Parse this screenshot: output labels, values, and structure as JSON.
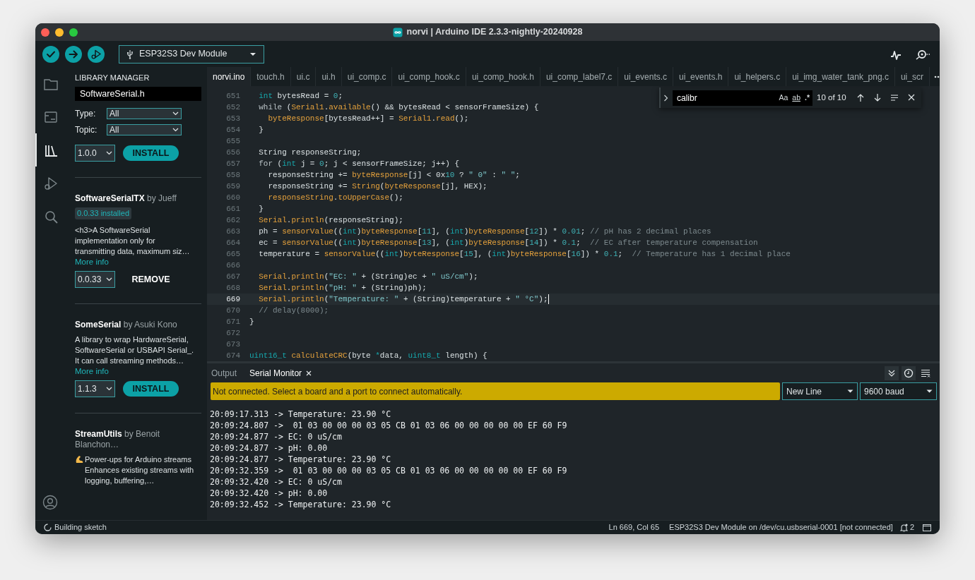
{
  "window": {
    "title": "norvi | Arduino IDE 2.3.3-nightly-20240928"
  },
  "toolbar": {
    "buttons": [
      {
        "kind": "verify"
      },
      {
        "kind": "upload"
      },
      {
        "kind": "debug"
      }
    ],
    "board": "ESP32S3 Dev Module",
    "right": [
      {
        "kind": "plotter"
      },
      {
        "kind": "monitor"
      }
    ]
  },
  "activity_bar": [
    {
      "kind": "folder",
      "selected": false
    },
    {
      "kind": "boards",
      "selected": false
    },
    {
      "kind": "library",
      "selected": true
    },
    {
      "kind": "debug",
      "selected": false
    },
    {
      "kind": "search",
      "selected": false
    }
  ],
  "library_manager": {
    "title": "LIBRARY MANAGER",
    "search": "SoftwareSerial.h",
    "filters": [
      {
        "label": "Type:",
        "value": "All"
      },
      {
        "label": "Topic:",
        "value": "All"
      }
    ],
    "items": [
      {
        "version": "1.0.0",
        "action": {
          "kind": "install",
          "label": "INSTALL"
        }
      },
      {
        "heading": "**SoftwareSerialTX** by Jueff",
        "installed": "0.0.33 installed",
        "description": "<h3>A SoftwareSerial implementation only for transmitting data, maximum siz…",
        "more_info": "More info",
        "version": "0.0.33",
        "action": {
          "kind": "remove",
          "label": "REMOVE"
        }
      },
      {
        "heading": "**SomeSerial** by Asuki Kono",
        "description": "A library to wrap HardwareSerial, SoftwareSerial or USBAPI Serial_. It can call streaming methods…",
        "more_info": "More info",
        "version": "1.1.3",
        "action": {
          "kind": "install",
          "label": "INSTALL"
        }
      },
      {
        "heading": "**StreamUtils** by Benoit Blanchon…",
        "emoji_icon": true,
        "description": "Power-ups for Arduino streams Enhances existing streams with logging, buffering,…"
      }
    ]
  },
  "editor_tabs": [
    {
      "label": "norvi.ino",
      "selected": true
    },
    {
      "label": "touch.h",
      "selected": false
    },
    {
      "label": "ui.c",
      "selected": false
    },
    {
      "label": "ui.h",
      "selected": false
    },
    {
      "label": "ui_comp.c",
      "selected": false
    },
    {
      "label": "ui_comp_hook.c",
      "selected": false
    },
    {
      "label": "ui_comp_hook.h",
      "selected": false
    },
    {
      "label": "ui_comp_label7.c",
      "selected": false
    },
    {
      "label": "ui_events.c",
      "selected": false
    },
    {
      "label": "ui_events.h",
      "selected": false
    },
    {
      "label": "ui_helpers.c",
      "selected": false
    },
    {
      "label": "ui_img_water_tank_png.c",
      "selected": false
    },
    {
      "label": "ui_scr",
      "selected": false
    }
  ],
  "find": {
    "query": "calibr",
    "options": [
      "Aa",
      "ab",
      ".*"
    ],
    "count": "10 of 10"
  },
  "code_lines": [
    {
      "number": "651",
      "current": false,
      "tokens": [
        {
          "kind": "type",
          "text": "  int"
        },
        {
          "kind": "plain",
          "text": " bytesRead = "
        },
        {
          "kind": "num",
          "text": "0"
        },
        {
          "kind": "plain",
          "text": ";"
        }
      ]
    },
    {
      "number": "652",
      "current": false,
      "tokens": [
        {
          "kind": "kw",
          "text": "  while"
        },
        {
          "kind": "plain",
          "text": " ("
        },
        {
          "kind": "fn",
          "text": "Serial1"
        },
        {
          "kind": "plain",
          "text": "."
        },
        {
          "kind": "fn",
          "text": "available"
        },
        {
          "kind": "plain",
          "text": "() && bytesRead < sensorFrameSize) {"
        }
      ]
    },
    {
      "number": "653",
      "current": false,
      "tokens": [
        {
          "kind": "fn",
          "text": "    byteResponse"
        },
        {
          "kind": "plain",
          "text": "[bytesRead++] = "
        },
        {
          "kind": "fn",
          "text": "Serial1"
        },
        {
          "kind": "plain",
          "text": "."
        },
        {
          "kind": "fn",
          "text": "read"
        },
        {
          "kind": "plain",
          "text": "();"
        }
      ]
    },
    {
      "number": "654",
      "current": false,
      "tokens": [
        {
          "kind": "plain",
          "text": "  }"
        }
      ]
    },
    {
      "number": "655",
      "current": false
    },
    {
      "number": "656",
      "current": false,
      "tokens": [
        {
          "kind": "plain",
          "text": "  String responseString;"
        }
      ]
    },
    {
      "number": "657",
      "current": false,
      "tokens": [
        {
          "kind": "kw",
          "text": "  for"
        },
        {
          "kind": "plain",
          "text": " ("
        },
        {
          "kind": "type",
          "text": "int"
        },
        {
          "kind": "plain",
          "text": " j = "
        },
        {
          "kind": "num",
          "text": "0"
        },
        {
          "kind": "plain",
          "text": "; j < sensorFrameSize; j++) {"
        }
      ]
    },
    {
      "number": "658",
      "current": false,
      "tokens": [
        {
          "kind": "plain",
          "text": "    responseString += "
        },
        {
          "kind": "fn",
          "text": "byteResponse"
        },
        {
          "kind": "plain",
          "text": "[j] < 0x"
        },
        {
          "kind": "num",
          "text": "10"
        },
        {
          "kind": "plain",
          "text": " ? "
        },
        {
          "kind": "str",
          "text": "\" 0\""
        },
        {
          "kind": "plain",
          "text": " : "
        },
        {
          "kind": "str",
          "text": "\" \""
        },
        {
          "kind": "plain",
          "text": ";"
        }
      ]
    },
    {
      "number": "659",
      "current": false,
      "tokens": [
        {
          "kind": "plain",
          "text": "    responseString += "
        },
        {
          "kind": "fn",
          "text": "String"
        },
        {
          "kind": "plain",
          "text": "("
        },
        {
          "kind": "fn",
          "text": "byteResponse"
        },
        {
          "kind": "plain",
          "text": "[j], HEX);"
        }
      ]
    },
    {
      "number": "660",
      "current": false,
      "tokens": [
        {
          "kind": "fn",
          "text": "    responseString"
        },
        {
          "kind": "plain",
          "text": "."
        },
        {
          "kind": "fn",
          "text": "toUpperCase"
        },
        {
          "kind": "plain",
          "text": "();"
        }
      ]
    },
    {
      "number": "661",
      "current": false,
      "tokens": [
        {
          "kind": "plain",
          "text": "  }"
        }
      ]
    },
    {
      "number": "662",
      "current": false,
      "tokens": [
        {
          "kind": "fn",
          "text": "  Serial"
        },
        {
          "kind": "plain",
          "text": "."
        },
        {
          "kind": "fn",
          "text": "println"
        },
        {
          "kind": "plain",
          "text": "(responseString);"
        }
      ]
    },
    {
      "number": "663",
      "current": false,
      "tokens": [
        {
          "kind": "plain",
          "text": "  ph = "
        },
        {
          "kind": "fn",
          "text": "sensorValue"
        },
        {
          "kind": "plain",
          "text": "(("
        },
        {
          "kind": "type",
          "text": "int"
        },
        {
          "kind": "plain",
          "text": ")"
        },
        {
          "kind": "fn",
          "text": "byteResponse"
        },
        {
          "kind": "plain",
          "text": "["
        },
        {
          "kind": "num",
          "text": "11"
        },
        {
          "kind": "plain",
          "text": "], ("
        },
        {
          "kind": "type",
          "text": "int"
        },
        {
          "kind": "plain",
          "text": ")"
        },
        {
          "kind": "fn",
          "text": "byteResponse"
        },
        {
          "kind": "plain",
          "text": "["
        },
        {
          "kind": "num",
          "text": "12"
        },
        {
          "kind": "plain",
          "text": "]) * "
        },
        {
          "kind": "num",
          "text": "0.01"
        },
        {
          "kind": "plain",
          "text": "; "
        },
        {
          "kind": "comment",
          "text": "// pH has 2 decimal places"
        }
      ]
    },
    {
      "number": "664",
      "current": false,
      "tokens": [
        {
          "kind": "plain",
          "text": "  ec = "
        },
        {
          "kind": "fn",
          "text": "sensorValue"
        },
        {
          "kind": "plain",
          "text": "(("
        },
        {
          "kind": "type",
          "text": "int"
        },
        {
          "kind": "plain",
          "text": ")"
        },
        {
          "kind": "fn",
          "text": "byteResponse"
        },
        {
          "kind": "plain",
          "text": "["
        },
        {
          "kind": "num",
          "text": "13"
        },
        {
          "kind": "plain",
          "text": "], ("
        },
        {
          "kind": "type",
          "text": "int"
        },
        {
          "kind": "plain",
          "text": ")"
        },
        {
          "kind": "fn",
          "text": "byteResponse"
        },
        {
          "kind": "plain",
          "text": "["
        },
        {
          "kind": "num",
          "text": "14"
        },
        {
          "kind": "plain",
          "text": "]) * "
        },
        {
          "kind": "num",
          "text": "0.1"
        },
        {
          "kind": "plain",
          "text": ";"
        },
        {
          "kind": "comment",
          "text": "  // EC after temperature compensation"
        }
      ]
    },
    {
      "number": "665",
      "current": false,
      "tokens": [
        {
          "kind": "plain",
          "text": "  temperature = "
        },
        {
          "kind": "fn",
          "text": "sensorValue"
        },
        {
          "kind": "plain",
          "text": "(("
        },
        {
          "kind": "type",
          "text": "int"
        },
        {
          "kind": "plain",
          "text": ")"
        },
        {
          "kind": "fn",
          "text": "byteResponse"
        },
        {
          "kind": "plain",
          "text": "["
        },
        {
          "kind": "num",
          "text": "15"
        },
        {
          "kind": "plain",
          "text": "], ("
        },
        {
          "kind": "type",
          "text": "int"
        },
        {
          "kind": "plain",
          "text": ")"
        },
        {
          "kind": "fn",
          "text": "byteResponse"
        },
        {
          "kind": "plain",
          "text": "["
        },
        {
          "kind": "num",
          "text": "16"
        },
        {
          "kind": "plain",
          "text": "]) * "
        },
        {
          "kind": "num",
          "text": "0.1"
        },
        {
          "kind": "plain",
          "text": ";"
        },
        {
          "kind": "comment",
          "text": "  // Temperature has 1 decimal place"
        }
      ]
    },
    {
      "number": "666",
      "current": false
    },
    {
      "number": "667",
      "current": false,
      "tokens": [
        {
          "kind": "fn",
          "text": "  Serial"
        },
        {
          "kind": "plain",
          "text": "."
        },
        {
          "kind": "fn",
          "text": "println"
        },
        {
          "kind": "plain",
          "text": "("
        },
        {
          "kind": "str",
          "text": "\"EC: \""
        },
        {
          "kind": "plain",
          "text": " + (String)ec + "
        },
        {
          "kind": "str",
          "text": "\" uS/cm\""
        },
        {
          "kind": "plain",
          "text": ");"
        }
      ]
    },
    {
      "number": "668",
      "current": false,
      "tokens": [
        {
          "kind": "fn",
          "text": "  Serial"
        },
        {
          "kind": "plain",
          "text": "."
        },
        {
          "kind": "fn",
          "text": "println"
        },
        {
          "kind": "plain",
          "text": "("
        },
        {
          "kind": "str",
          "text": "\"pH: \""
        },
        {
          "kind": "plain",
          "text": " + (String)ph);"
        }
      ]
    },
    {
      "number": "669",
      "current": true,
      "tokens": [
        {
          "kind": "fn",
          "text": "  Serial"
        },
        {
          "kind": "plain",
          "text": "."
        },
        {
          "kind": "fn",
          "text": "println"
        },
        {
          "kind": "plain",
          "text": "("
        },
        {
          "kind": "str",
          "text": "\"Temperature: \""
        },
        {
          "kind": "plain",
          "text": " + (String)temperature + "
        },
        {
          "kind": "str",
          "text": "\" °C\""
        },
        {
          "kind": "plain",
          "text": ");"
        }
      ]
    },
    {
      "number": "670",
      "current": false,
      "tokens": [
        {
          "kind": "comment",
          "text": "  // delay(8000);"
        }
      ]
    },
    {
      "number": "671",
      "current": false,
      "tokens": [
        {
          "kind": "plain",
          "text": "}"
        }
      ]
    },
    {
      "number": "672",
      "current": false
    },
    {
      "number": "673",
      "current": false
    },
    {
      "number": "674",
      "current": false,
      "tokens": [
        {
          "kind": "type",
          "text": "uint16_t"
        },
        {
          "kind": "fn",
          "text": " calculateCRC"
        },
        {
          "kind": "plain",
          "text": "(byte "
        },
        {
          "kind": "type",
          "text": "*"
        },
        {
          "kind": "plain",
          "text": "data, "
        },
        {
          "kind": "type",
          "text": "uint8_t"
        },
        {
          "kind": "plain",
          "text": " length) {"
        }
      ]
    }
  ],
  "panel": {
    "tabs": [
      {
        "label": "Output",
        "selected": false,
        "closable": false
      },
      {
        "label": "Serial Monitor",
        "selected": true,
        "closable": true
      }
    ],
    "notice": "Not connected. Select a board and a port to connect automatically.",
    "line_ending": "New Line",
    "baud": "9600 baud",
    "serial_lines": [
      "20:09:17.313 -> Temperature: 23.90 °C",
      "20:09:24.807 ->  01 03 00 00 00 03 05 CB 01 03 06 00 00 00 00 00 EF 60 F9",
      "20:09:24.877 -> EC: 0 uS/cm",
      "20:09:24.877 -> pH: 0.00",
      "20:09:24.877 -> Temperature: 23.90 °C",
      "20:09:32.359 ->  01 03 00 00 00 03 05 CB 01 03 06 00 00 00 00 00 EF 60 F9",
      "20:09:32.420 -> EC: 0 uS/cm",
      "20:09:32.420 -> pH: 0.00",
      "20:09:32.452 -> Temperature: 23.90 °C"
    ]
  },
  "status_bar": {
    "task": "Building sketch",
    "position": "Ln 669, Col 65",
    "board": "ESP32S3 Dev Module on /dev/cu.usbserial-0001 [not connected]",
    "notifications": "2"
  }
}
